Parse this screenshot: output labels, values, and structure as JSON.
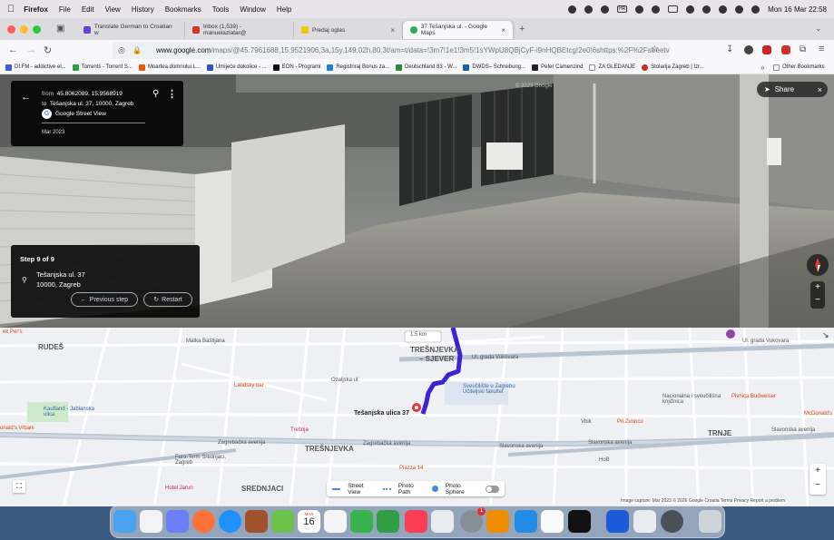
{
  "menubar": {
    "app": "Firefox",
    "items": [
      "File",
      "Edit",
      "View",
      "History",
      "Bookmarks",
      "Tools",
      "Window",
      "Help"
    ],
    "datetime": "Mon 16 Mar  22:58"
  },
  "tabs": [
    {
      "title": "Translate German to Croatian w",
      "color": "#6a3fd8"
    },
    {
      "title": "Inbox (1,539) - manuelazlatar@",
      "color": "#d93025"
    },
    {
      "title": "Predaj oglas",
      "color": "#f5c400"
    },
    {
      "title": "37 Tešanjska ul. - Google Maps",
      "color": "#34a853"
    }
  ],
  "url": {
    "domain": "www.google.com",
    "path": "/maps/@45.7961688,15.9521906,3a,15y,149.02h,80.3t/am=t/data=!3m7!1e1!3m5!1sYWpU8QBjCyF-i9nHQBEtcg!2e0!6shttps:%2F%2Fstreetv"
  },
  "bookmarks": [
    {
      "label": "DI.FM - addictive el...",
      "color": "#3b5bdb"
    },
    {
      "label": "Torrents - Torrent S...",
      "color": "#2f9e44"
    },
    {
      "label": "Moartea.domnului.L...",
      "color": "#e8590c"
    },
    {
      "label": "Umijeće dokolice - ...",
      "color": "#364fc7"
    },
    {
      "label": "EON - Programi",
      "color": "#111"
    },
    {
      "label": "Registriraj Bonus za...",
      "color": "#1c7ed6"
    },
    {
      "label": "Deutschland 83 - W...",
      "color": "#2b8a3e"
    },
    {
      "label": "DWDS– Schreibung...",
      "color": "#1864ab"
    },
    {
      "label": "Peter Camenzind",
      "color": "#212529"
    },
    {
      "label": "ZA GLEDANJE",
      "color": "#868e96"
    },
    {
      "label": "Stolarija Zagreb | Izr...",
      "color": "#c92a2a"
    }
  ],
  "bookmarks_other": "Other Bookmarks",
  "streetview": {
    "from_label": "from",
    "from_value": "45.8062089, 15.9568919",
    "to_label": "to",
    "to_value": "Tešanjska ul. 37, 10000, Zagreb",
    "source": "Google Street View",
    "date": "Mar 2023",
    "share": "Share",
    "watermark": "© 2023 Google"
  },
  "step": {
    "title": "Step 9 of 9",
    "line1": "Tešanjska ul. 37",
    "line2": "10000, Zagreb",
    "prev": "Previous step",
    "restart": "Restart"
  },
  "map": {
    "labels": {
      "rudes": "RUDEŠ",
      "tresnjevka_n": "TREŠNJEVKA",
      "tresnjevka_n2": "– SJEVER",
      "tresnjevka_s": "TREŠNJEVKA",
      "srednjaci": "SREDNJACI",
      "trnje": "TRNJE",
      "matka": "Matka Baštijana",
      "ozaljska": "Ozaljska ul.",
      "vukovar": "Ul. grada Vukovara",
      "vukovar2": "Ul. grada Vukovara",
      "zagrebacka": "Zagrebačka avenija",
      "zagrebacka2": "Zagrebačka avenija",
      "slavonska": "Slavonska avenija",
      "slavonska2": "Slavonska avenija",
      "slavonska3": "Slavonska avenija",
      "tesanjska": "Tešanjska ulica 37",
      "sveuciliste": "Sveučilište u Zagrebu Učiteljski fakultet",
      "kaufland": "Kaufland - Jablanska ulica",
      "landsky": "Landsky bar",
      "tresnja": "Trešnja",
      "ferotem": "Fero-Term Srednjaci, Zagreb",
      "hotel": "Hotel Jarun",
      "piazza": "Piazza 14",
      "pivnica": "Pivnica Budweiser",
      "zvoncu": "Pri Zvoncu",
      "nacionalna": "Nacionalna i sveučilišna knjižnica",
      "mcdonalds": "McDonald's",
      "vbik": "Vbik",
      "hob": "HoB",
      "pers": "ek Per's",
      "onalds": "onald's Vrbani",
      "distance": "1.5 km"
    },
    "legend": {
      "street_view": "Street View",
      "photo_path": "Photo Path",
      "photo_sphere": "Photo Sphere"
    },
    "footer": "Image capture: Mar 2023   © 2026 Google   Croatia   Terms   Privacy   Report a problem"
  },
  "dock": {
    "calendar_month": "MAR",
    "calendar_day": "16",
    "badge": "1"
  }
}
